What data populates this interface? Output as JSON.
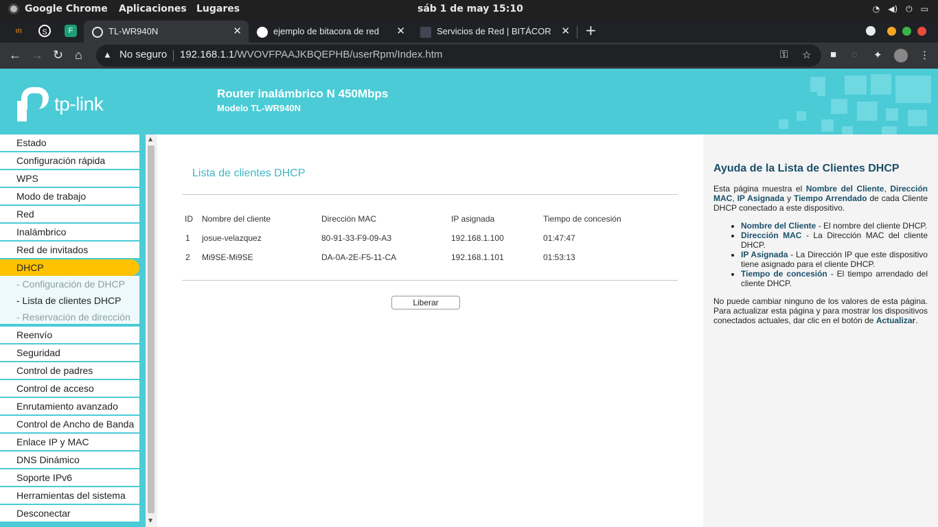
{
  "system": {
    "app_name": "Google Chrome",
    "menu_apps": "Aplicaciones",
    "menu_places": "Lugares",
    "clock": "sáb  1 de may  15:10"
  },
  "browser": {
    "tabs": [
      {
        "title": "TL-WR940N",
        "active": true
      },
      {
        "title": "ejemplo de bitacora de red",
        "active": false
      },
      {
        "title": "Servicios de Red | BITÁCOR",
        "active": false
      }
    ],
    "not_secure": "No seguro",
    "url_host": "192.168.1.1",
    "url_path": "/WVOVFPAAJKBQEPHB/userRpm/Index.htm"
  },
  "header": {
    "logo": "tp-link",
    "product": "Router inalámbrico N 450Mbps",
    "model": "Modelo TL-WR940N"
  },
  "sidebar": {
    "items": [
      "Estado",
      "Configuración rápida",
      "WPS",
      "Modo de trabajo",
      "Red",
      "Inalámbrico",
      "Red de invitados",
      "DHCP"
    ],
    "subitems": [
      "- Configuración de DHCP",
      "- Lista de clientes DHCP",
      "- Reservación de dirección"
    ],
    "items_after": [
      "Reenvío",
      "Seguridad",
      "Control de padres",
      "Control de acceso",
      "Enrutamiento avanzado",
      "Control de Ancho de Banda",
      "Enlace IP y MAC",
      "DNS Dinámico",
      "Soporte IPv6",
      "Herramientas del sistema",
      "Desconectar"
    ]
  },
  "main": {
    "title": "Lista de clientes DHCP",
    "columns": [
      "ID",
      "Nombre del cliente",
      "Dirección MAC",
      "IP asignada",
      "Tiempo de concesión"
    ],
    "rows": [
      [
        "1",
        "josue-velazquez",
        "80-91-33-F9-09-A3",
        "192.168.1.100",
        "01:47:47"
      ],
      [
        "2",
        "Mi9SE-Mi9SE",
        "DA-0A-2E-F5-11-CA",
        "192.168.1.101",
        "01:53:13"
      ]
    ],
    "release_button": "Liberar"
  },
  "help": {
    "title": "Ayuda de la Lista de Clientes DHCP",
    "intro_1": "Esta página muestra el ",
    "intro_b1": "Nombre del Cliente",
    "intro_2": ", ",
    "intro_b2": "Dirección MAC",
    "intro_3": ", ",
    "intro_b3": "IP Asignada",
    "intro_4": " y ",
    "intro_b4": "Tiempo Arrendado",
    "intro_5": " de cada Cliente DHCP conectado a este dispositivo.",
    "bullets": [
      {
        "term": "Nombre del Cliente",
        "desc": " - El nombre del cliente DHCP."
      },
      {
        "term": "Dirección MAC",
        "desc": " - La Dirección MAC del cliente DHCP."
      },
      {
        "term": "IP Asignada",
        "desc": " - La Dirección IP que este dispositivo tiene asignado para el cliente DHCP."
      },
      {
        "term": "Tiempo de concesión",
        "desc": " - El tiempo arrendado del cliente DHCP."
      }
    ],
    "note_1": "No puede cambiar ninguno de los valores de esta página. Para actualizar esta página y para mostrar los dispositivos conectados actuales, dar clic en el botón de ",
    "note_b": "Actualizar",
    "note_2": "."
  },
  "colors": {
    "brand": "#4acbd6",
    "selected": "#fec200",
    "title": "#3fb7c7"
  }
}
